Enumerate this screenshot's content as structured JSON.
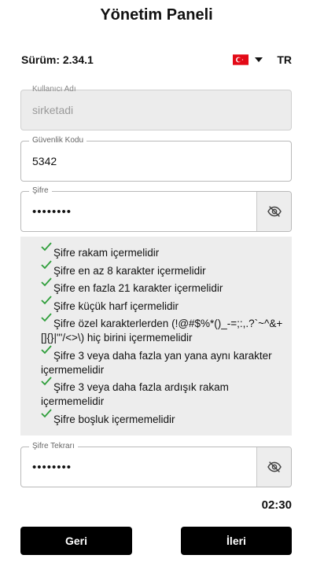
{
  "header": {
    "title": "Yönetim Paneli"
  },
  "info": {
    "version": "Sürüm: 2.34.1",
    "language_code": "TR",
    "flag_icon": "turkey-flag-icon"
  },
  "fields": {
    "username": {
      "label": "Kullanıcı Adı",
      "value": "sirketadi",
      "disabled": true
    },
    "security_code": {
      "label": "Güvenlik Kodu",
      "value": "5342"
    },
    "password": {
      "label": "Şifre",
      "value": "••••••••",
      "toggle_icon": "eye-slash-icon"
    },
    "password_repeat": {
      "label": "Şifre Tekrarı",
      "value": "••••••••",
      "toggle_icon": "eye-slash-icon"
    }
  },
  "rules": [
    "Şifre rakam içermelidir",
    "Şifre en az 8 karakter içermelidir",
    "Şifre en fazla 21 karakter içermelidir",
    "Şifre küçük harf içermelidir",
    "Şifre özel karakterlerden (!@#$%*()_-=;:,.?`~^&+[]{}|\"'/<>\\) hiç birini içermemelidir",
    "Şifre 3 veya daha fazla yan yana aynı karakter içermemelidir",
    "Şifre 3 veya daha fazla ardışık rakam içermemelidir",
    "Şifre boşluk içermemelidir"
  ],
  "timer": "02:30",
  "buttons": {
    "back": "Geri",
    "next": "İleri"
  },
  "colors": {
    "check": "#2e9e3a",
    "button_bg": "#000000",
    "flag_red": "#e30a17"
  }
}
